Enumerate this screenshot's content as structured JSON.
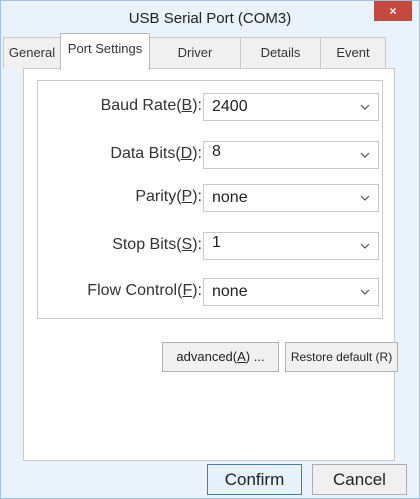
{
  "window": {
    "title": "USB Serial Port (COM3)",
    "close_label": "×"
  },
  "tabs": [
    {
      "label": "General",
      "active": false
    },
    {
      "label": "Port Settings",
      "active": true
    },
    {
      "label": "Driver",
      "active": false
    },
    {
      "label": "Details",
      "active": false
    },
    {
      "label": "Event",
      "active": false
    }
  ],
  "settings": {
    "baud_rate": {
      "label_prefix": "Baud Rate(",
      "mnemonic": "B",
      "label_suffix": "):",
      "value": "2400"
    },
    "data_bits": {
      "label_prefix": "Data Bits(",
      "mnemonic": "D",
      "label_suffix": "):",
      "value": "8"
    },
    "parity": {
      "label_prefix": "Parity(",
      "mnemonic": "P",
      "label_suffix": "):",
      "value": "none"
    },
    "stop_bits": {
      "label_prefix": "Stop Bits(",
      "mnemonic": "S",
      "label_suffix": "):",
      "value": "1"
    },
    "flow_control": {
      "label_prefix": "Flow Control(",
      "mnemonic": "F",
      "label_suffix": "):",
      "value": "none"
    }
  },
  "buttons": {
    "advanced_prefix": "advanced(",
    "advanced_mnemonic": "A",
    "advanced_suffix": ") ...",
    "restore": "Restore default (R)",
    "confirm": "Confirm",
    "cancel": "Cancel"
  },
  "colors": {
    "window_bg": "#eaf2fb",
    "close_bg": "#c44a3f",
    "primary_border": "#3c7fb1"
  }
}
